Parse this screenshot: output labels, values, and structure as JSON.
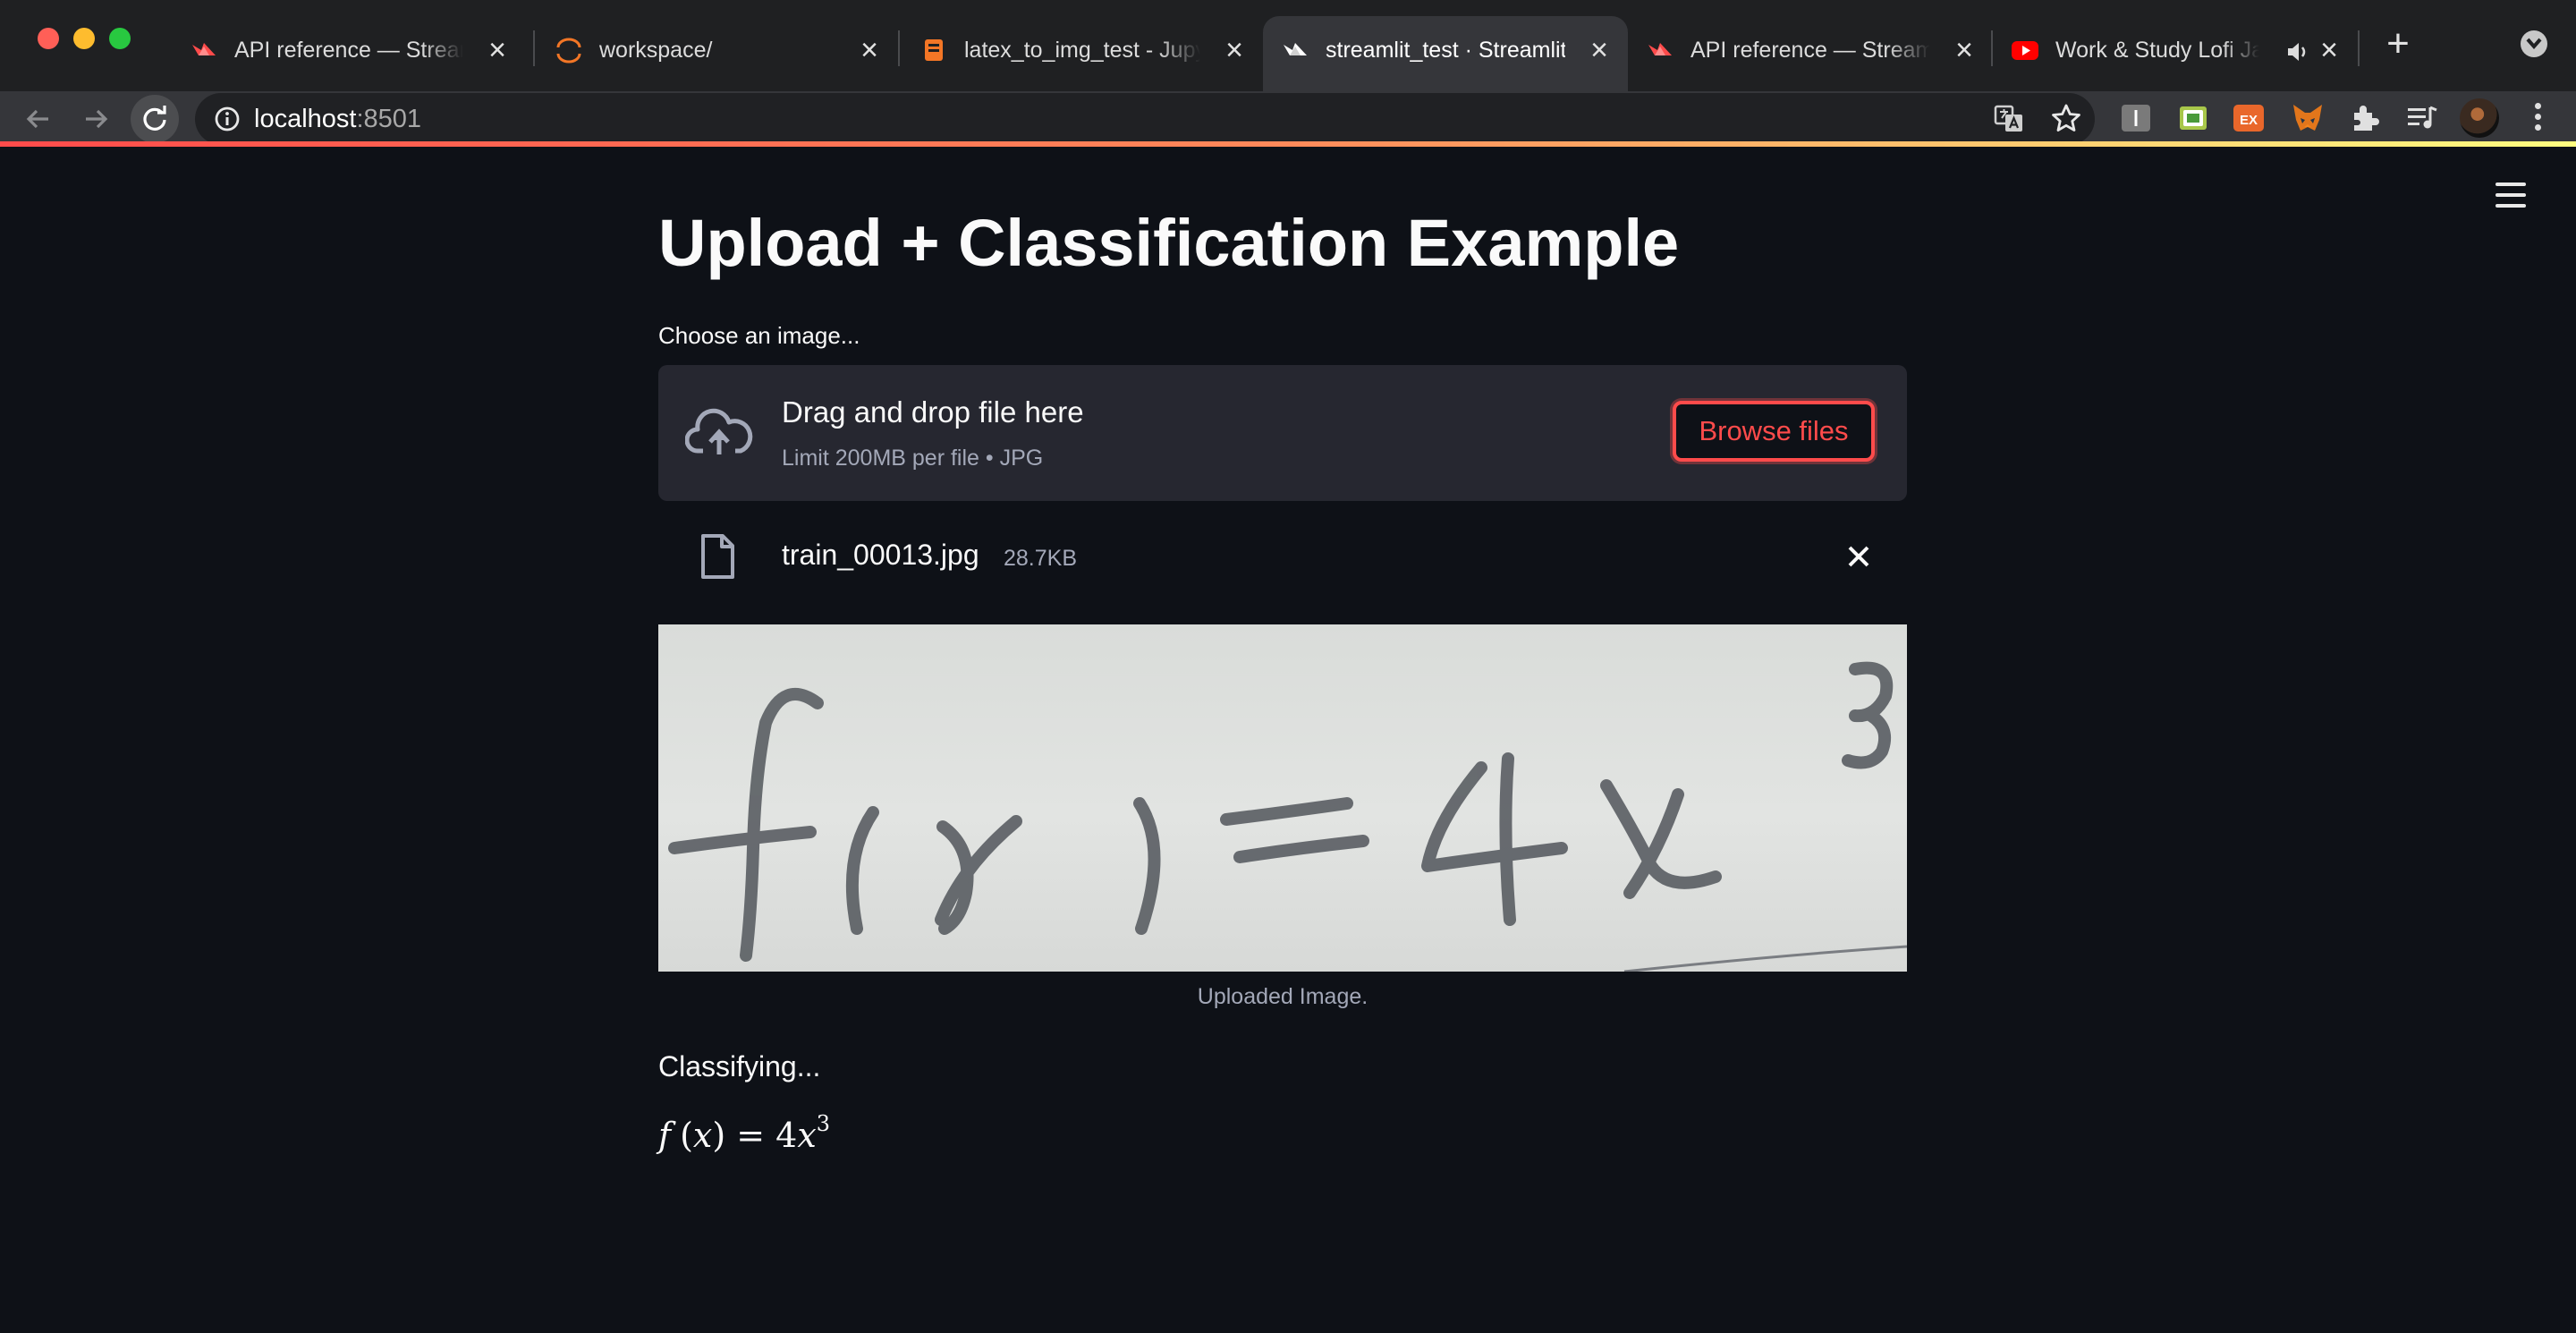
{
  "browser": {
    "tabs": [
      {
        "title": "API reference — Streamlit",
        "favicon": "streamlit-crown-icon",
        "active": false
      },
      {
        "title": "workspace/",
        "favicon": "jupyter-icon",
        "active": false
      },
      {
        "title": "latex_to_img_test - Jupyter",
        "favicon": "jupyter-notebook-icon",
        "active": false
      },
      {
        "title": "streamlit_test · Streamlit",
        "favicon": "streamlit-crown-icon",
        "active": true
      },
      {
        "title": "API reference — Streamlit",
        "favicon": "streamlit-crown-icon",
        "active": false
      },
      {
        "title": "Work & Study Lofi Jazz",
        "favicon": "youtube-icon",
        "active": false
      }
    ],
    "address": {
      "host": "localhost",
      "port": ":8501"
    },
    "toolbar_icons": [
      "back-icon",
      "forward-icon",
      "reload-icon",
      "site-info-icon",
      "translate-icon",
      "bookmark-star-icon",
      "extensions-icon",
      "media-control-icon",
      "profile-avatar",
      "menu-icon"
    ]
  },
  "app": {
    "title": "Upload + Classification Example",
    "uploader": {
      "label": "Choose an image...",
      "drop_text": "Drag and drop file here",
      "limit_text": "Limit 200MB per file • JPG",
      "browse_label": "Browse files"
    },
    "file": {
      "name": "train_00013.jpg",
      "size": "28.7KB"
    },
    "image_caption": "Uploaded Image.",
    "status": "Classifying...",
    "result": {
      "f": "f",
      "x": "x",
      "coef": "4",
      "exp": "3"
    },
    "colors": {
      "primary": "#ff4b4b",
      "background": "#0e1117",
      "secondary_bg": "#262730",
      "text": "#fafafa"
    }
  }
}
